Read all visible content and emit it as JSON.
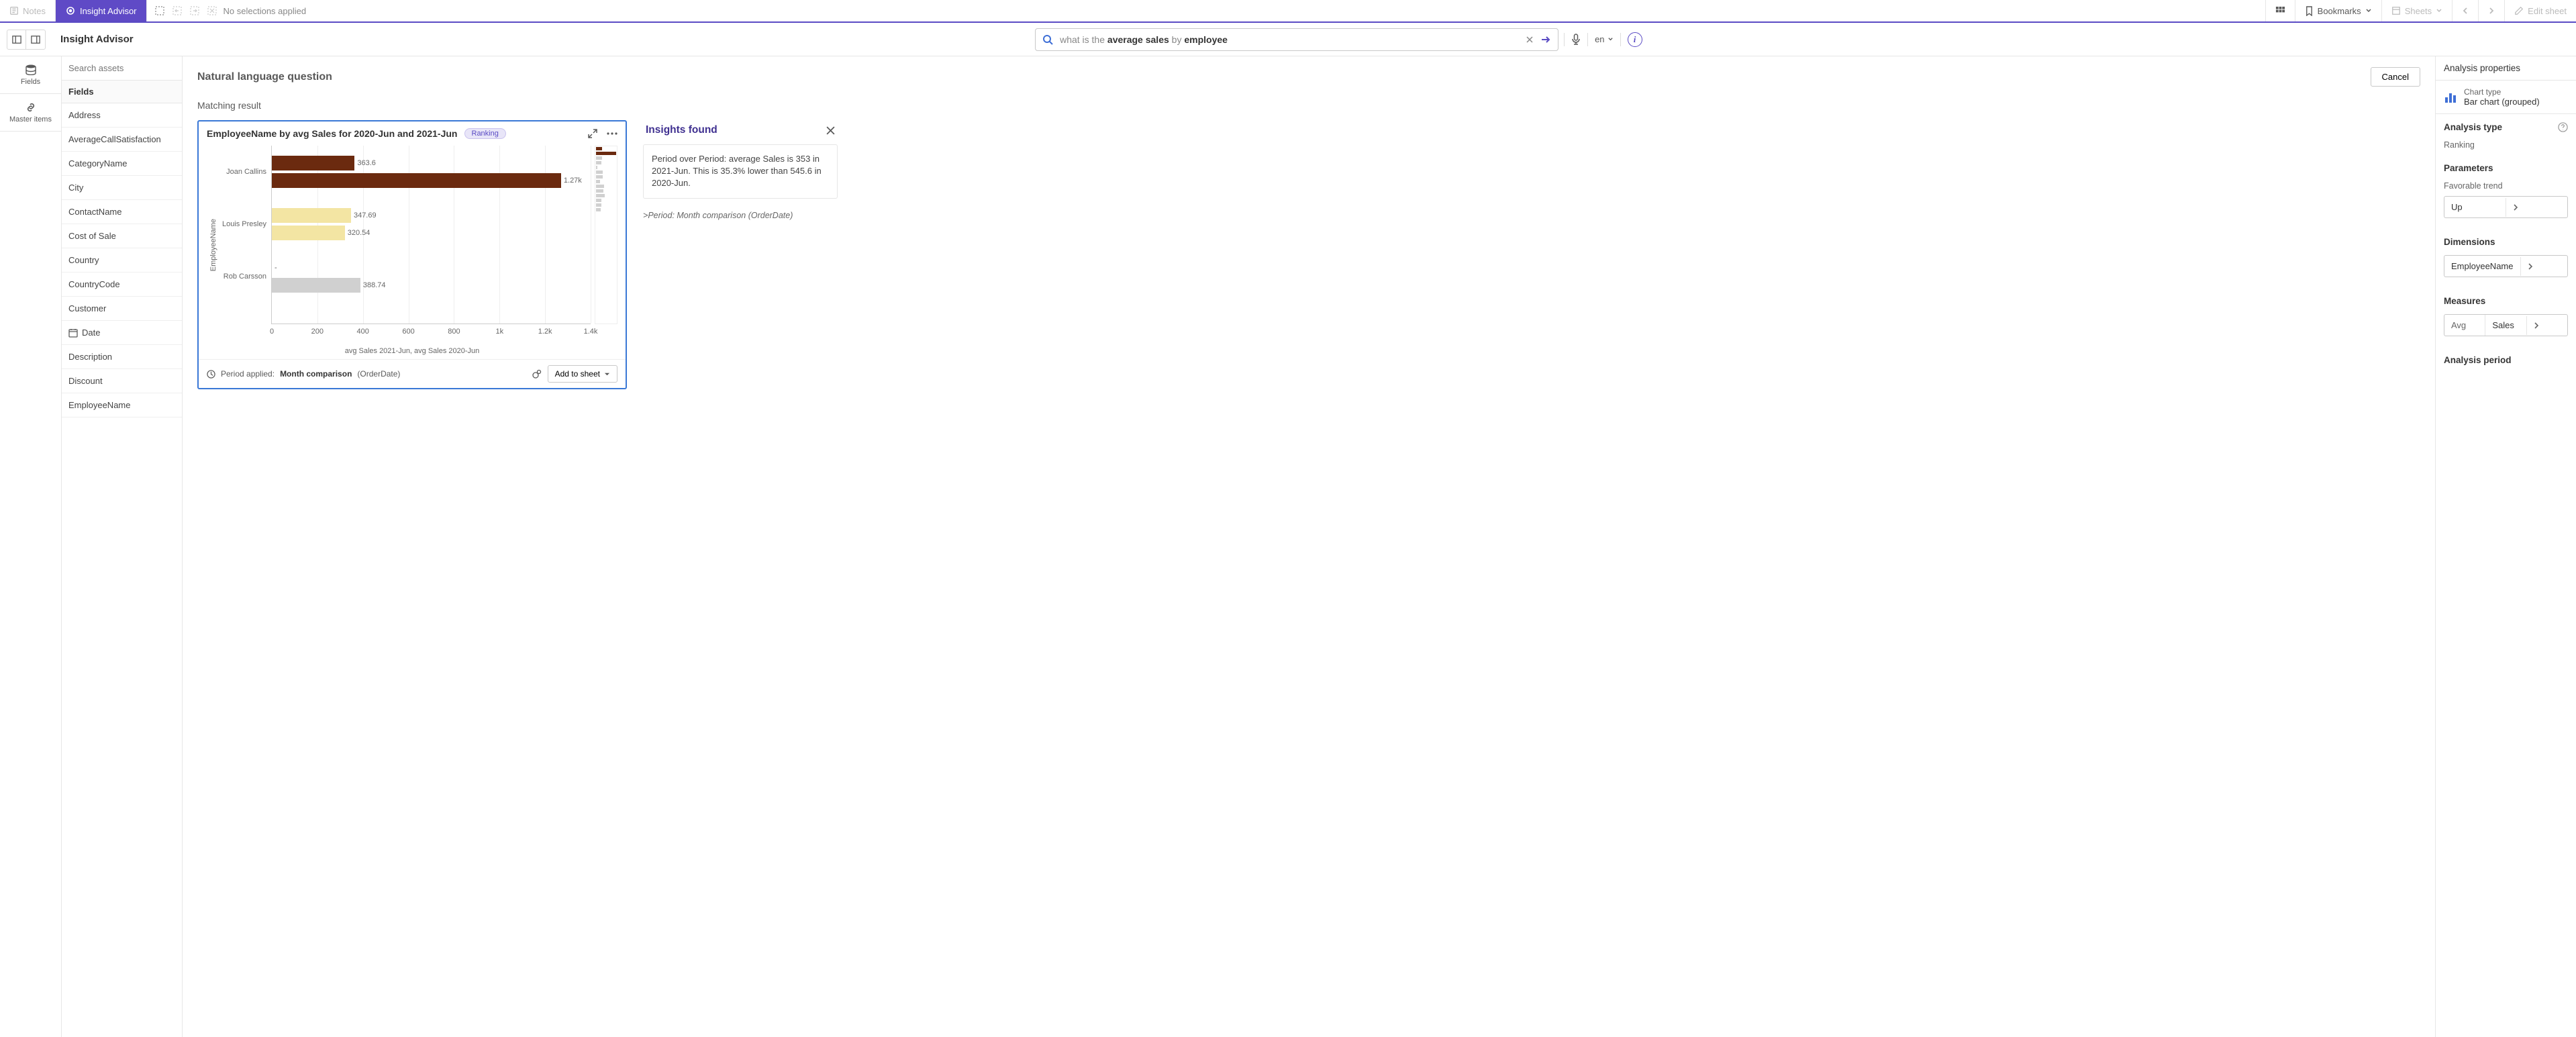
{
  "toolbar": {
    "notes": "Notes",
    "insight_advisor": "Insight Advisor",
    "no_selections": "No selections applied",
    "bookmarks": "Bookmarks",
    "sheets": "Sheets",
    "edit_sheet": "Edit sheet"
  },
  "subbar": {
    "title": "Insight Advisor",
    "query_prefix": "what is the ",
    "query_mid1": "average sales",
    "query_mid2": " by ",
    "query_tail": "employee",
    "lang": "en"
  },
  "rail": {
    "fields": "Fields",
    "master": "Master items"
  },
  "assets": {
    "search_placeholder": "Search assets",
    "section": "Fields",
    "items": [
      {
        "label": "Address",
        "icon": ""
      },
      {
        "label": "AverageCallSatisfaction",
        "icon": ""
      },
      {
        "label": "CategoryName",
        "icon": ""
      },
      {
        "label": "City",
        "icon": ""
      },
      {
        "label": "ContactName",
        "icon": ""
      },
      {
        "label": "Cost of Sale",
        "icon": ""
      },
      {
        "label": "Country",
        "icon": ""
      },
      {
        "label": "CountryCode",
        "icon": ""
      },
      {
        "label": "Customer",
        "icon": ""
      },
      {
        "label": "Date",
        "icon": "date"
      },
      {
        "label": "Description",
        "icon": ""
      },
      {
        "label": "Discount",
        "icon": ""
      },
      {
        "label": "EmployeeName",
        "icon": ""
      }
    ]
  },
  "center": {
    "heading": "Natural language question",
    "cancel": "Cancel",
    "matching": "Matching result",
    "chart_title": "EmployeeName by avg Sales for 2020-Jun and 2021-Jun",
    "badge": "Ranking",
    "yaxis": "EmployeeName",
    "xaxis_legend": "avg Sales 2021-Jun, avg Sales 2020-Jun",
    "period_label": "Period applied:",
    "period_name": "Month comparison",
    "period_field": "(OrderDate)",
    "add_to_sheet": "Add to sheet"
  },
  "chart_data": {
    "type": "bar",
    "orientation": "horizontal",
    "xlabel": "",
    "ylabel": "EmployeeName",
    "xlim": [
      0,
      1400
    ],
    "xticks": [
      0,
      200,
      400,
      600,
      800,
      1000,
      1200,
      1400
    ],
    "xtick_labels": [
      "0",
      "200",
      "400",
      "600",
      "800",
      "1k",
      "1.2k",
      "1.4k"
    ],
    "categories": [
      "Joan Callins",
      "Louis Presley",
      "Rob Carsson"
    ],
    "series": [
      {
        "name": "avg Sales 2021-Jun",
        "color": "#6b2a0f",
        "values": [
          363.6,
          347.69,
          null
        ],
        "labels": [
          "363.6",
          "347.69",
          "-"
        ]
      },
      {
        "name": "avg Sales 2020-Jun",
        "color": "#6b2a0f",
        "values": [
          1270,
          320.54,
          388.74
        ],
        "labels": [
          "1.27k",
          "320.54",
          "388.74"
        ]
      }
    ],
    "row_colors": [
      "#6b2a0f",
      "#f3e5a3",
      "#d0d0d0"
    ]
  },
  "insights": {
    "heading": "Insights found",
    "text": "Period over Period: average Sales is 353 in 2021-Jun. This is 35.3% lower than 545.6 in 2020-Jun.",
    "sub_prefix": ">",
    "sub": "Period: Month comparison (OrderDate)"
  },
  "props": {
    "heading": "Analysis properties",
    "chart_type_label": "Chart type",
    "chart_type_value": "Bar chart (grouped)",
    "analysis_type_label": "Analysis type",
    "analysis_type_value": "Ranking",
    "parameters": "Parameters",
    "fav_trend_label": "Favorable trend",
    "fav_trend_value": "Up",
    "dimensions_label": "Dimensions",
    "dimension_value": "EmployeeName",
    "measures_label": "Measures",
    "measure_agg": "Avg",
    "measure_value": "Sales",
    "analysis_period": "Analysis period"
  }
}
